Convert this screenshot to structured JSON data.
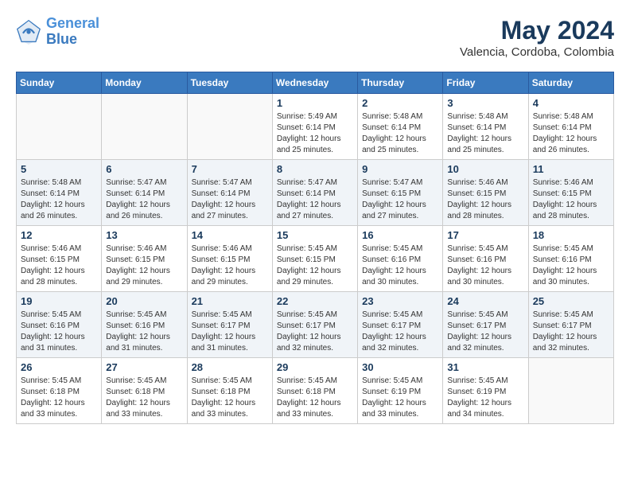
{
  "header": {
    "logo_line1": "General",
    "logo_line2": "Blue",
    "month_year": "May 2024",
    "location": "Valencia, Cordoba, Colombia"
  },
  "days_of_week": [
    "Sunday",
    "Monday",
    "Tuesday",
    "Wednesday",
    "Thursday",
    "Friday",
    "Saturday"
  ],
  "weeks": [
    [
      {
        "day": "",
        "info": ""
      },
      {
        "day": "",
        "info": ""
      },
      {
        "day": "",
        "info": ""
      },
      {
        "day": "1",
        "info": "Sunrise: 5:49 AM\nSunset: 6:14 PM\nDaylight: 12 hours\nand 25 minutes."
      },
      {
        "day": "2",
        "info": "Sunrise: 5:48 AM\nSunset: 6:14 PM\nDaylight: 12 hours\nand 25 minutes."
      },
      {
        "day": "3",
        "info": "Sunrise: 5:48 AM\nSunset: 6:14 PM\nDaylight: 12 hours\nand 25 minutes."
      },
      {
        "day": "4",
        "info": "Sunrise: 5:48 AM\nSunset: 6:14 PM\nDaylight: 12 hours\nand 26 minutes."
      }
    ],
    [
      {
        "day": "5",
        "info": "Sunrise: 5:48 AM\nSunset: 6:14 PM\nDaylight: 12 hours\nand 26 minutes."
      },
      {
        "day": "6",
        "info": "Sunrise: 5:47 AM\nSunset: 6:14 PM\nDaylight: 12 hours\nand 26 minutes."
      },
      {
        "day": "7",
        "info": "Sunrise: 5:47 AM\nSunset: 6:14 PM\nDaylight: 12 hours\nand 27 minutes."
      },
      {
        "day": "8",
        "info": "Sunrise: 5:47 AM\nSunset: 6:14 PM\nDaylight: 12 hours\nand 27 minutes."
      },
      {
        "day": "9",
        "info": "Sunrise: 5:47 AM\nSunset: 6:15 PM\nDaylight: 12 hours\nand 27 minutes."
      },
      {
        "day": "10",
        "info": "Sunrise: 5:46 AM\nSunset: 6:15 PM\nDaylight: 12 hours\nand 28 minutes."
      },
      {
        "day": "11",
        "info": "Sunrise: 5:46 AM\nSunset: 6:15 PM\nDaylight: 12 hours\nand 28 minutes."
      }
    ],
    [
      {
        "day": "12",
        "info": "Sunrise: 5:46 AM\nSunset: 6:15 PM\nDaylight: 12 hours\nand 28 minutes."
      },
      {
        "day": "13",
        "info": "Sunrise: 5:46 AM\nSunset: 6:15 PM\nDaylight: 12 hours\nand 29 minutes."
      },
      {
        "day": "14",
        "info": "Sunrise: 5:46 AM\nSunset: 6:15 PM\nDaylight: 12 hours\nand 29 minutes."
      },
      {
        "day": "15",
        "info": "Sunrise: 5:45 AM\nSunset: 6:15 PM\nDaylight: 12 hours\nand 29 minutes."
      },
      {
        "day": "16",
        "info": "Sunrise: 5:45 AM\nSunset: 6:16 PM\nDaylight: 12 hours\nand 30 minutes."
      },
      {
        "day": "17",
        "info": "Sunrise: 5:45 AM\nSunset: 6:16 PM\nDaylight: 12 hours\nand 30 minutes."
      },
      {
        "day": "18",
        "info": "Sunrise: 5:45 AM\nSunset: 6:16 PM\nDaylight: 12 hours\nand 30 minutes."
      }
    ],
    [
      {
        "day": "19",
        "info": "Sunrise: 5:45 AM\nSunset: 6:16 PM\nDaylight: 12 hours\nand 31 minutes."
      },
      {
        "day": "20",
        "info": "Sunrise: 5:45 AM\nSunset: 6:16 PM\nDaylight: 12 hours\nand 31 minutes."
      },
      {
        "day": "21",
        "info": "Sunrise: 5:45 AM\nSunset: 6:17 PM\nDaylight: 12 hours\nand 31 minutes."
      },
      {
        "day": "22",
        "info": "Sunrise: 5:45 AM\nSunset: 6:17 PM\nDaylight: 12 hours\nand 32 minutes."
      },
      {
        "day": "23",
        "info": "Sunrise: 5:45 AM\nSunset: 6:17 PM\nDaylight: 12 hours\nand 32 minutes."
      },
      {
        "day": "24",
        "info": "Sunrise: 5:45 AM\nSunset: 6:17 PM\nDaylight: 12 hours\nand 32 minutes."
      },
      {
        "day": "25",
        "info": "Sunrise: 5:45 AM\nSunset: 6:17 PM\nDaylight: 12 hours\nand 32 minutes."
      }
    ],
    [
      {
        "day": "26",
        "info": "Sunrise: 5:45 AM\nSunset: 6:18 PM\nDaylight: 12 hours\nand 33 minutes."
      },
      {
        "day": "27",
        "info": "Sunrise: 5:45 AM\nSunset: 6:18 PM\nDaylight: 12 hours\nand 33 minutes."
      },
      {
        "day": "28",
        "info": "Sunrise: 5:45 AM\nSunset: 6:18 PM\nDaylight: 12 hours\nand 33 minutes."
      },
      {
        "day": "29",
        "info": "Sunrise: 5:45 AM\nSunset: 6:18 PM\nDaylight: 12 hours\nand 33 minutes."
      },
      {
        "day": "30",
        "info": "Sunrise: 5:45 AM\nSunset: 6:19 PM\nDaylight: 12 hours\nand 33 minutes."
      },
      {
        "day": "31",
        "info": "Sunrise: 5:45 AM\nSunset: 6:19 PM\nDaylight: 12 hours\nand 34 minutes."
      },
      {
        "day": "",
        "info": ""
      }
    ]
  ]
}
